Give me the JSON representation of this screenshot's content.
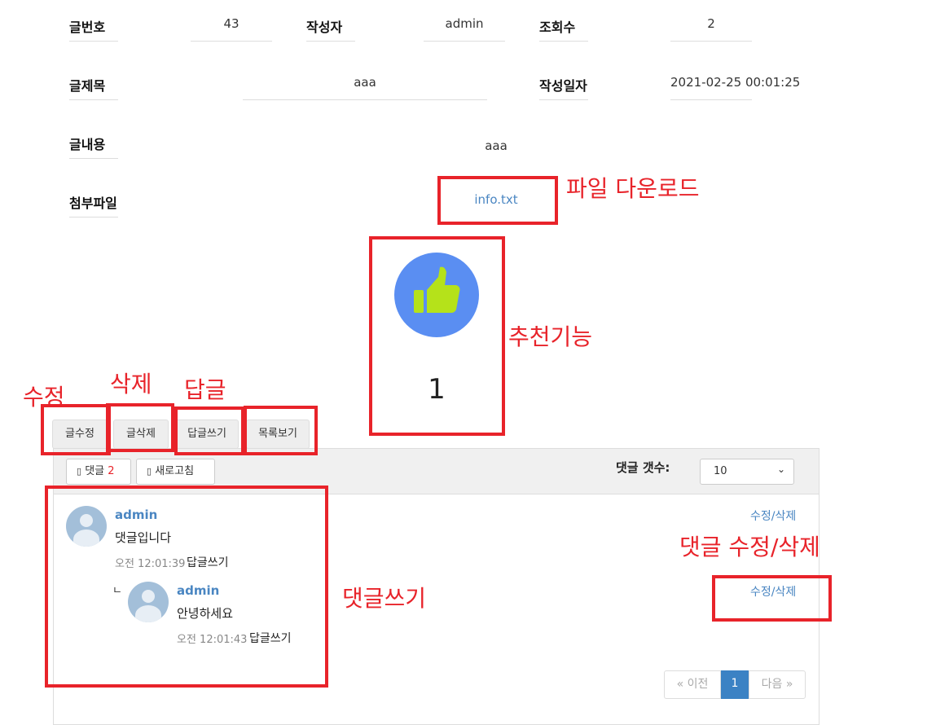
{
  "post": {
    "no_label": "글번호",
    "no_value": "43",
    "writer_label": "작성자",
    "writer_value": "admin",
    "views_label": "조회수",
    "views_value": "2",
    "title_label": "글제목",
    "title_value": "aaa",
    "date_label": "작성일자",
    "date_value": "2021-02-25 00:01:25",
    "content_label": "글내용",
    "content_value": "aaa",
    "file_label": "첨부파일",
    "file_value": "info.txt"
  },
  "like": {
    "count": "1",
    "bg_color": "#5a8ef2",
    "thumb_color": "#b5e21a"
  },
  "buttons": {
    "edit": "글수정",
    "delete": "글삭제",
    "reply": "답글쓰기",
    "list": "목록보기"
  },
  "comments_header": {
    "comment_btn_icon": "▯",
    "comment_btn_label": "댓글",
    "comment_count": "2",
    "refresh_icon": "▯",
    "refresh_label": "새로고침",
    "page_size_label": "댓글 갯수:",
    "page_size_value": "10"
  },
  "comments": [
    {
      "user": "admin",
      "text": "댓글입니다",
      "time": "오전 12:01:39",
      "reply": "답글쓰기",
      "action": "수정/삭제"
    },
    {
      "user": "admin",
      "text": "안녕하세요",
      "time": "오전 12:01:43",
      "reply": "답글쓰기",
      "action": "수정/삭제",
      "indent_marker": "ㄴ"
    }
  ],
  "pagination": {
    "prev": "« 이전",
    "current": "1",
    "next": "다음 »"
  },
  "annotations": {
    "file_download": "파일 다운로드",
    "recommend": "추천기능",
    "edit": "수정",
    "delete": "삭제",
    "reply": "답글",
    "comment_edit_delete": "댓글 수정/삭제",
    "comment_write": "댓글쓰기",
    "color": "#e8232a"
  }
}
